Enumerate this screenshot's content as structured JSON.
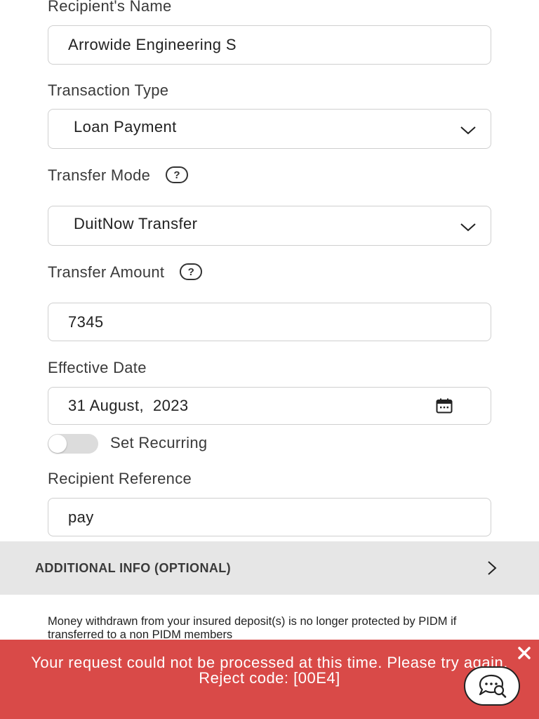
{
  "form": {
    "recipient_name": {
      "label": "Recipient's Name",
      "value": "Arrowide Engineering S"
    },
    "transaction_type": {
      "label": "Transaction Type",
      "value": "Loan Payment"
    },
    "transfer_mode": {
      "label": "Transfer Mode",
      "value": "DuitNow Transfer",
      "help": "?"
    },
    "transfer_amount": {
      "label": "Transfer Amount",
      "value": "7345",
      "help": "?"
    },
    "effective_date": {
      "label": "Effective Date",
      "value": "31 August,  2023"
    },
    "recurring": {
      "label": "Set Recurring",
      "enabled": false
    },
    "recipient_reference": {
      "label": "Recipient Reference",
      "value": "pay"
    }
  },
  "additional_info": {
    "label": "ADDITIONAL INFO (OPTIONAL)"
  },
  "notice": {
    "text": "Money withdrawn from your insured deposit(s) is no longer protected by PIDM if transferred to a non PIDM members"
  },
  "error": {
    "message": "Your request could not be processed at this time. Please try again. Reject code: [00E4]"
  },
  "icons": {
    "chevron": "chevron-down-icon",
    "help": "help-circle-icon",
    "calendar": "calendar-icon",
    "arrow": "chevron-right-icon",
    "close": "close-icon",
    "chat": "chat-icon"
  },
  "colors": {
    "error_bg": "#d94a48",
    "section_bg": "#e6e6e6",
    "border": "#cfcfcf"
  }
}
